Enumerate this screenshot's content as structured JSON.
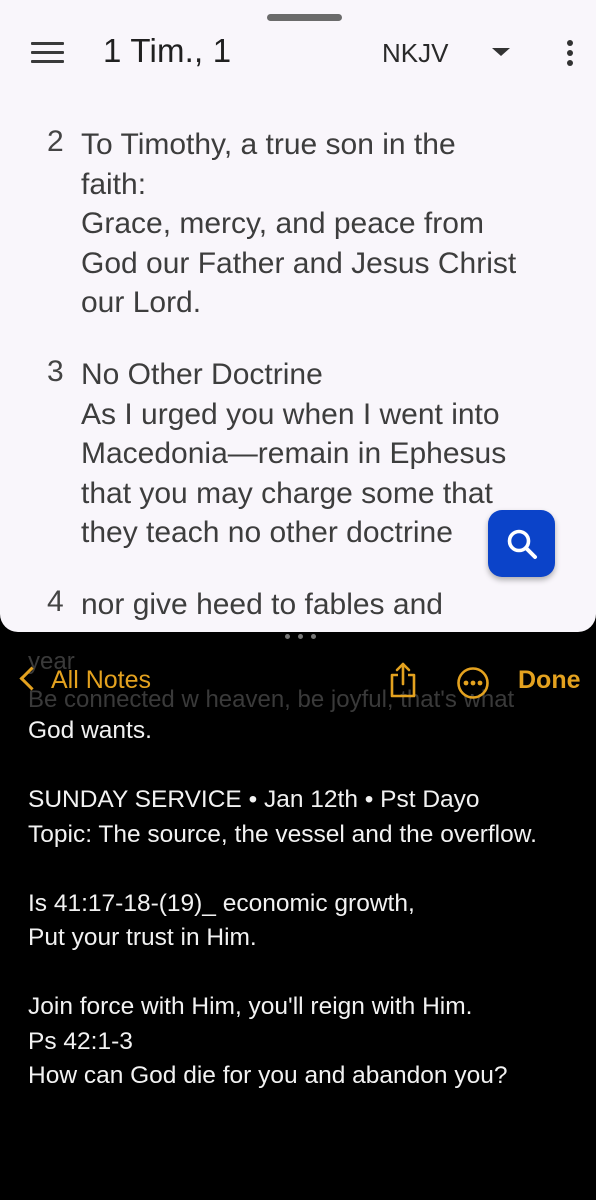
{
  "bible": {
    "book_ref": "1 Tim., 1",
    "version": "NKJV",
    "verses": [
      {
        "num": "2",
        "lines": [
          "To Timothy, a true son in the",
          "faith:",
          "Grace, mercy, and peace from",
          "God our Father and Jesus Christ",
          "our Lord."
        ]
      },
      {
        "num": "3",
        "lines": [
          "No Other Doctrine",
          "As I urged you when I went into",
          "Macedonia—remain in Ephesus",
          "that you may charge some that",
          "they teach no other doctrine"
        ]
      },
      {
        "num": "4",
        "lines": [
          "nor give heed to fables and"
        ]
      }
    ]
  },
  "notes": {
    "back_label": "All Notes",
    "done_label": "Done",
    "ghost_lines": [
      "year",
      "Be connected w heaven, be joyful, that's what"
    ],
    "body_lines": [
      "God wants.",
      "",
      "SUNDAY SERVICE • Jan 12th • Pst Dayo",
      "Topic: The source, the vessel and the overflow.",
      "",
      "Is 41:17-18-(19)_ economic growth,",
      "Put your trust in Him.",
      "",
      "Join force with Him, you'll reign with Him.",
      "Ps 42:1-3",
      "How can God die for you and abandon you?"
    ]
  },
  "colors": {
    "accent": "#e4a21f",
    "fab": "#0b43c9",
    "bible_bg": "#f9f6fb"
  }
}
